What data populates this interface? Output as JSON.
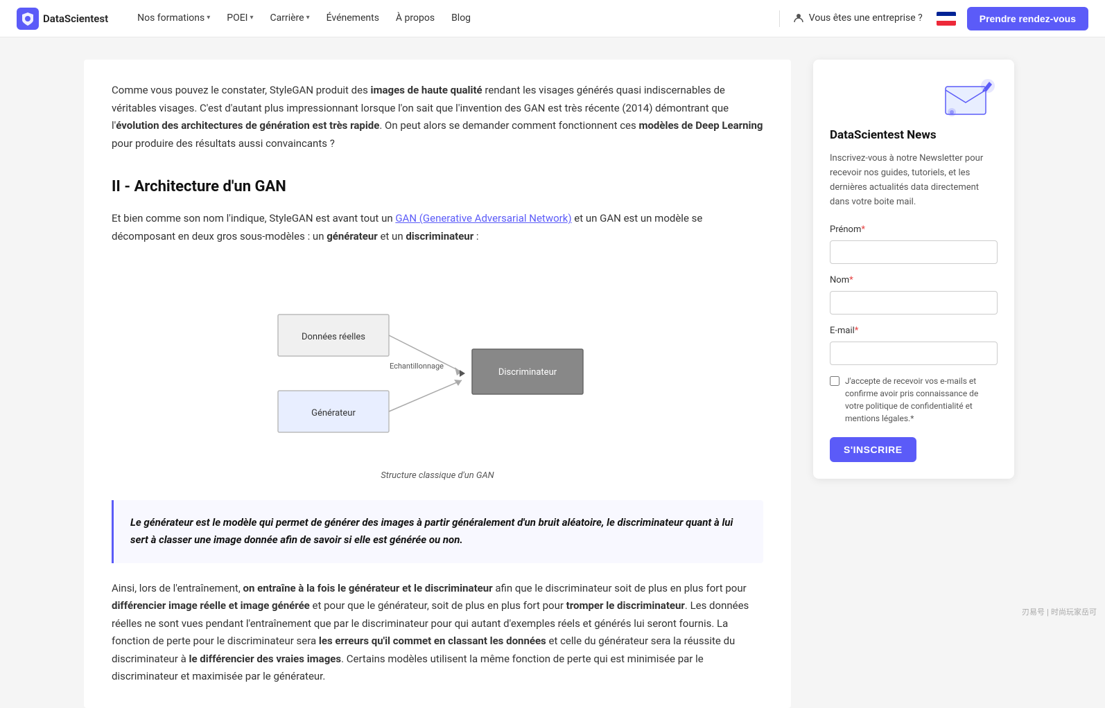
{
  "navbar": {
    "logo_text": "DataScientest",
    "nav_items": [
      {
        "label": "Nos formations",
        "has_chevron": true
      },
      {
        "label": "POEI",
        "has_chevron": true
      },
      {
        "label": "Carrière",
        "has_chevron": true
      },
      {
        "label": "Événements",
        "has_chevron": false
      },
      {
        "label": "À propos",
        "has_chevron": false
      },
      {
        "label": "Blog",
        "has_chevron": false
      }
    ],
    "enterprise_label": "Vous êtes une entreprise ?",
    "cta_label": "Prendre rendez-vous"
  },
  "main": {
    "intro": {
      "p1_plain1": "Comme vous pouvez le constater, StyleGAN produit des ",
      "p1_bold1": "images de haute qualité",
      "p1_plain2": " rendant les visages générés quasi indiscernables de véritables visages. C'est d'autant plus impressionnant lorsque l'on sait que l'invention des GAN est très récente (2014) démontrant que l'",
      "p1_bold2": "évolution des architectures de génération est très rapide",
      "p1_plain3": ". On peut alors se demander comment fonctionnent ces ",
      "p1_bold3": "modèles de Deep Learning",
      "p1_plain4": " pour produire des résultats aussi convaincants ?"
    },
    "section": {
      "title": "II - Architecture d'un GAN",
      "intro_plain1": "Et bien comme son nom l'indique, StyleGAN est avant tout un ",
      "intro_link": "GAN (Generative Adversarial Network)",
      "intro_plain2": " et un GAN est un modèle se décomposant en deux gros sous-modèles : un ",
      "intro_bold1": "générateur",
      "intro_plain3": " et un ",
      "intro_bold2": "discriminateur",
      "intro_plain4": " :"
    },
    "diagram": {
      "caption": "Structure classique d'un GAN",
      "box_donnees": "Données réelles",
      "box_generateur": "Générateur",
      "box_discriminateur": "Discriminateur",
      "label_echantillonnage": "Echantillonnage"
    },
    "blockquote": "Le générateur est le modèle qui permet de générer des images à partir généralement d'un bruit aléatoire, le discriminateur quant à lui sert à classer une image donnée afin de savoir si elle est générée ou non.",
    "conclusion": {
      "plain1": "Ainsi, lors de l'entraînement, ",
      "bold1": "on entraîne à la fois le générateur et le discriminateur",
      "plain2": " afin que le discriminateur soit de plus en plus fort pour ",
      "bold2": "différencier image réelle et image générée",
      "plain3": " et pour que le générateur, soit de plus en plus fort pour ",
      "bold3": "tromper le discriminateur",
      "plain4": ". Les données réelles ne sont vues pendant l'entraînement que par le discriminateur pour qui autant d'exemples réels et générés lui seront fournis. La fonction de perte pour le discriminateur sera ",
      "bold4": "les erreurs qu'il commet en classant les données",
      "plain5": " et celle du générateur sera la réussite du discriminateur à ",
      "bold5": "le différencier des vraies images",
      "plain6": ". Certains modèles utilisent la même fonction de perte qui est minimisée par le discriminateur et maximisée par le générateur."
    }
  },
  "sidebar": {
    "newsletter_title": "DataScientest News",
    "newsletter_desc": "Inscrivez-vous à notre Newsletter pour recevoir nos guides, tutoriels, et les dernières actualités data directement dans votre boite mail.",
    "form": {
      "prenom_label": "Prénom",
      "prenom_required": "*",
      "prenom_placeholder": "",
      "nom_label": "Nom",
      "nom_required": "*",
      "nom_placeholder": "",
      "email_label": "E-mail",
      "email_required": "*",
      "email_placeholder": "",
      "checkbox_text": "J'accepte de recevoir vos e-mails et confirme avoir pris connaissance de votre politique de confidentialité et mentions légales.",
      "checkbox_required": "*",
      "submit_label": "S'INSCRIRE"
    }
  },
  "watermark": "刃易号 | 时尚玩家岳可"
}
